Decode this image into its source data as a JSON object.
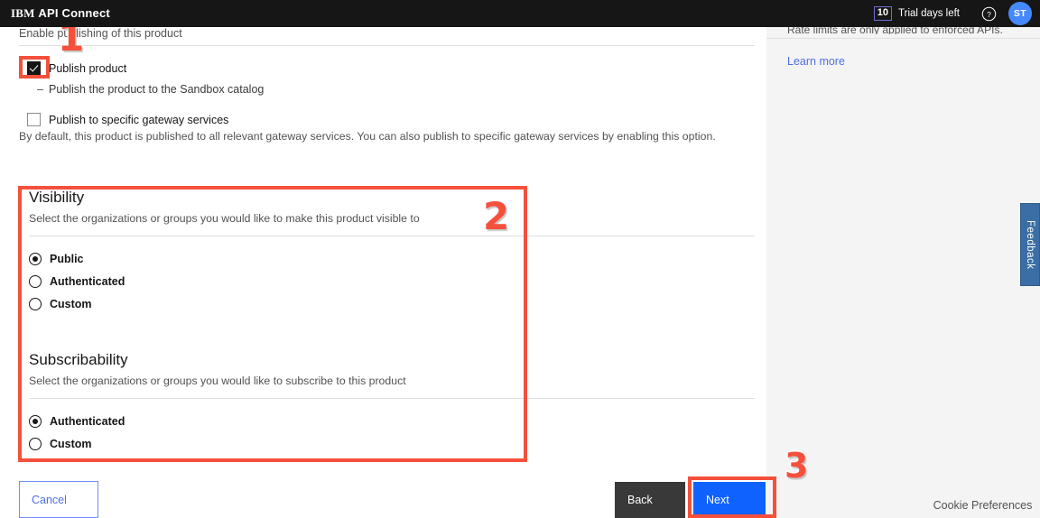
{
  "header": {
    "brand_ibm": "IBM",
    "brand_product": "API Connect",
    "trial_days": "10",
    "trial_label": "Trial days left",
    "help_icon": "help-circle-icon",
    "avatar_initials": "ST"
  },
  "main": {
    "enable_text": "Enable publishing of this product",
    "publish_product": {
      "label": "Publish product",
      "checked": true
    },
    "publish_sub_item": "Publish the product to the Sandbox catalog",
    "publish_sub_item_dash": "–",
    "publish_gateway": {
      "label": "Publish to specific gateway services",
      "checked": false
    },
    "gateway_helper": "By default, this product is published to all relevant gateway services. You can also publish to specific gateway services by enabling this option.",
    "visibility": {
      "title": "Visibility",
      "description": "Select the organizations or groups you would like to make this product visible to",
      "options": [
        {
          "label": "Public",
          "selected": true
        },
        {
          "label": "Authenticated",
          "selected": false
        },
        {
          "label": "Custom",
          "selected": false
        }
      ]
    },
    "subscribability": {
      "title": "Subscribability",
      "description": "Select the organizations or groups you would like to subscribe to this product",
      "options": [
        {
          "label": "Authenticated",
          "selected": true
        },
        {
          "label": "Custom",
          "selected": false
        }
      ]
    }
  },
  "footer": {
    "cancel_label": "Cancel",
    "back_label": "Back",
    "next_label": "Next"
  },
  "right_panel": {
    "cut_off_text": "Rate limits are only applied to enforced APIs.",
    "learn_more": "Learn more"
  },
  "feedback_tab": {
    "label": "Feedback"
  },
  "cookie": {
    "label": "Cookie Preferences"
  },
  "annotations": {
    "step_1": "1",
    "step_2": "2",
    "step_3": "3",
    "color": "#f4503c"
  }
}
